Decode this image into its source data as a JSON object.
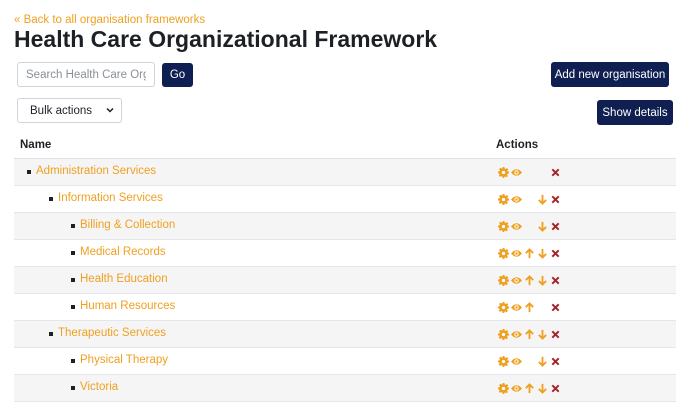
{
  "back_link": "« Back to all organisation frameworks",
  "page_title": "Health Care Organizational Framework",
  "search": {
    "placeholder": "Search Health Care Organi",
    "go_label": "Go"
  },
  "add_button_label": "Add new organisation",
  "show_details_label": "Show details",
  "bulk_actions": {
    "selected": "Bulk actions"
  },
  "table": {
    "col_name": "Name",
    "col_actions": "Actions"
  },
  "colors": {
    "accent": "#f0a020",
    "primary": "#0f1f52",
    "delete": "#a4262c"
  },
  "rows": [
    {
      "label": "Administration Services",
      "depth": 0,
      "actions": [
        "gear-icon",
        "eye-icon",
        "delete-icon"
      ]
    },
    {
      "label": "Information Services",
      "depth": 1,
      "actions": [
        "gear-icon",
        "eye-icon",
        "move-down-icon",
        "delete-icon"
      ]
    },
    {
      "label": "Billing & Collection",
      "depth": 2,
      "actions": [
        "gear-icon",
        "eye-icon",
        "move-down-icon",
        "delete-icon"
      ]
    },
    {
      "label": "Medical Records",
      "depth": 2,
      "actions": [
        "gear-icon",
        "eye-icon",
        "move-up-icon",
        "move-down-icon",
        "delete-icon"
      ]
    },
    {
      "label": "Health Education",
      "depth": 2,
      "actions": [
        "gear-icon",
        "eye-icon",
        "move-up-icon",
        "move-down-icon",
        "delete-icon"
      ]
    },
    {
      "label": "Human Resources",
      "depth": 2,
      "actions": [
        "gear-icon",
        "eye-icon",
        "move-up-icon",
        "delete-icon"
      ]
    },
    {
      "label": "Therapeutic Services",
      "depth": 1,
      "actions": [
        "gear-icon",
        "eye-icon",
        "move-up-icon",
        "move-down-icon",
        "delete-icon"
      ]
    },
    {
      "label": "Physical Therapy",
      "depth": 2,
      "actions": [
        "gear-icon",
        "eye-icon",
        "move-down-icon",
        "delete-icon"
      ]
    },
    {
      "label": "Victoria",
      "depth": 2,
      "actions": [
        "gear-icon",
        "eye-icon",
        "move-up-icon",
        "move-down-icon",
        "delete-icon"
      ]
    }
  ]
}
